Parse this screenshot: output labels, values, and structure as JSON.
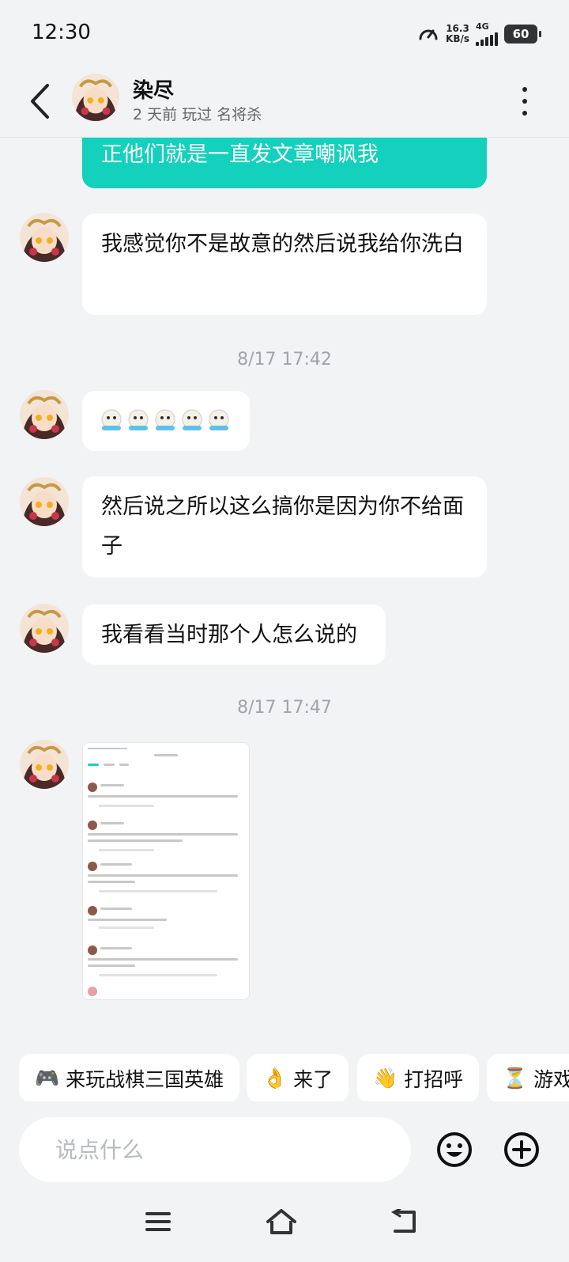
{
  "status_bar": {
    "time": "12:30",
    "net_speed_value": "16.3",
    "net_speed_unit": "KB/s",
    "network_type": "4G",
    "battery": "60"
  },
  "header": {
    "name": "染尽",
    "subtitle": "2 天前 玩过 名将杀"
  },
  "messages": {
    "own_partial": "正他们就是一直发文章嘲讽我",
    "msg1": "我感觉你不是故意的然后说我给你洗白",
    "timestamp1": "8/17  17:42",
    "msg3": "然后说之所以这么搞你是因为你不给面子",
    "msg4": "我看看当时那个人怎么说的",
    "timestamp2": "8/17  17:47"
  },
  "quick_replies": [
    {
      "icon": "🎮",
      "label": "来玩战棋三国英雄"
    },
    {
      "icon": "👌",
      "label": "来了"
    },
    {
      "icon": "👋",
      "label": "打招呼"
    },
    {
      "icon": "⏳",
      "label": "游戏"
    }
  ],
  "input": {
    "placeholder": "说点什么"
  },
  "icons": {
    "back": "chevron-left-icon",
    "more": "more-vertical-icon",
    "emoji": "smiley-icon",
    "plus": "plus-circle-icon",
    "nav_menu": "menu-icon",
    "nav_home": "home-icon",
    "nav_back": "back-icon"
  },
  "colors": {
    "own_bubble": "#14d1bd",
    "background": "#f2f3f5"
  }
}
